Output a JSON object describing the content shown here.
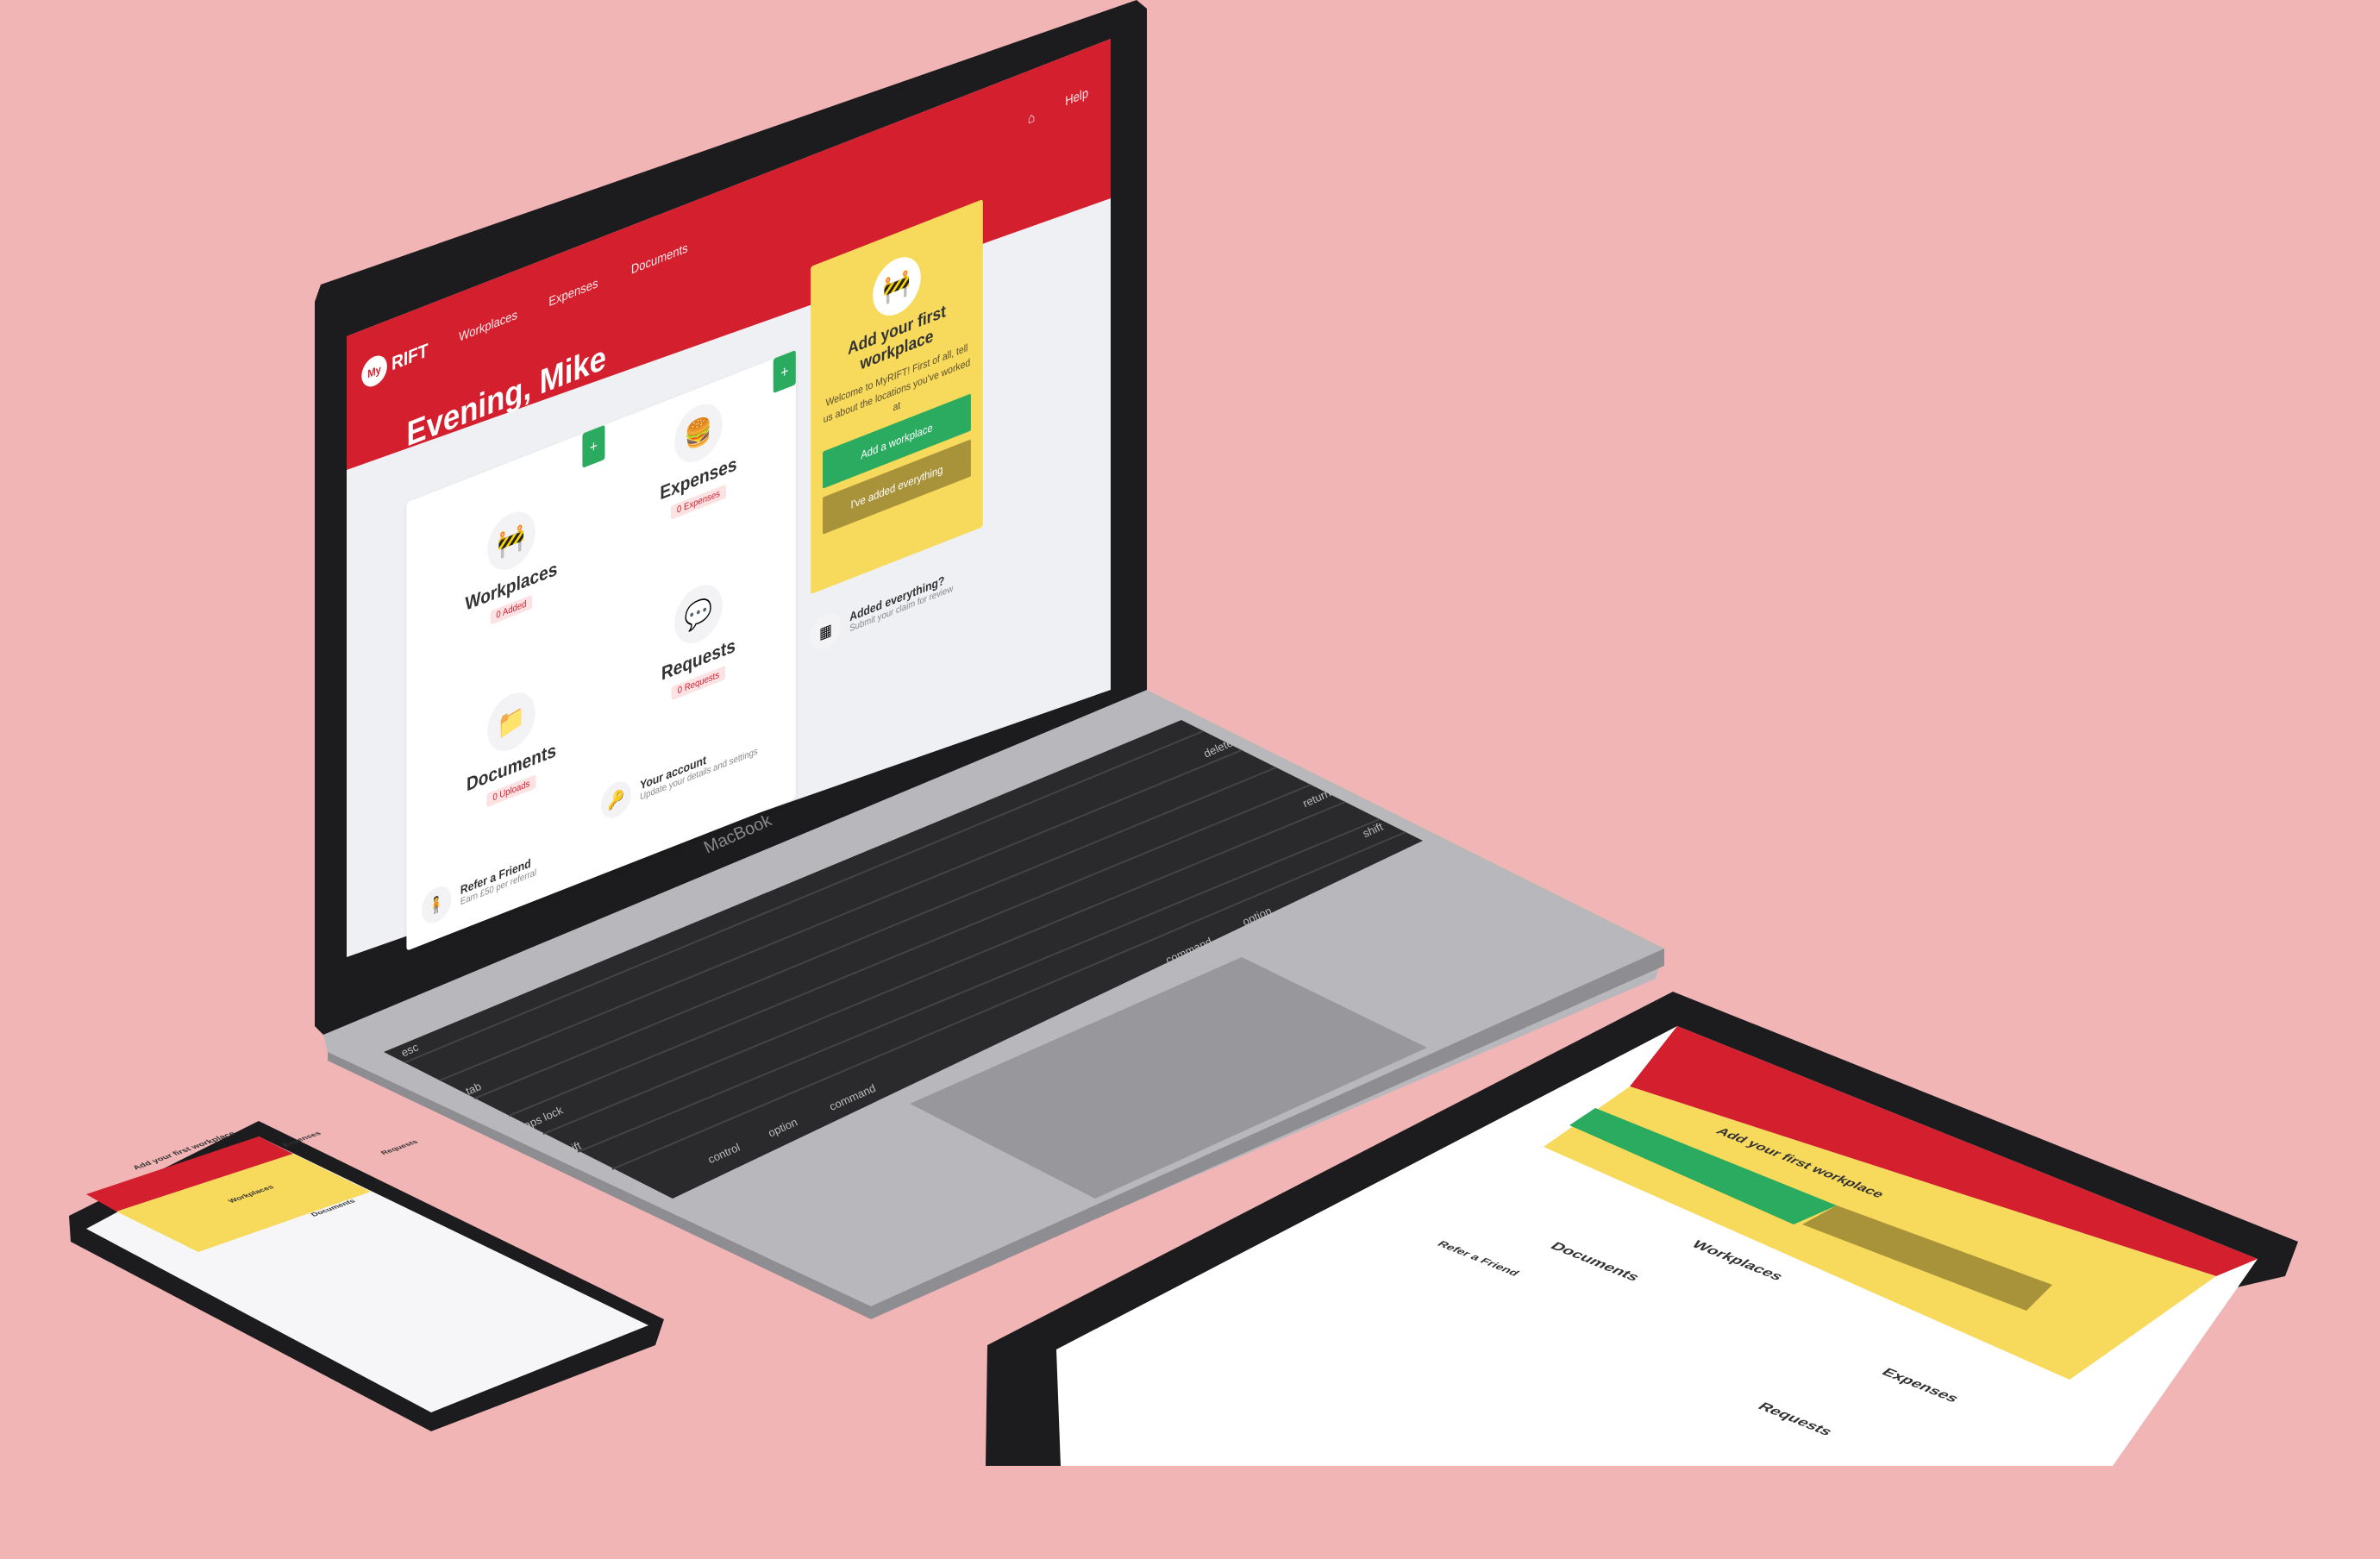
{
  "app": {
    "brand": "RIFT",
    "brand_prefix": "My",
    "nav": [
      "Workplaces",
      "Expenses",
      "Documents"
    ],
    "help_label": "Help",
    "greeting": "Evening, Mike"
  },
  "tiles": [
    {
      "title": "Workplaces",
      "badge": "0 Added",
      "icon": "barrier-icon"
    },
    {
      "title": "Expenses",
      "badge": "0 Expenses",
      "icon": "burger-icon"
    },
    {
      "title": "Requests",
      "badge": "0 Requests",
      "icon": "chat-icon"
    },
    {
      "title": "Documents",
      "badge": "0 Uploads",
      "icon": "folder-icon"
    }
  ],
  "promo": {
    "title": "Add your first workplace",
    "text": "Welcome to MyRIFT! First of all, tell us about the locations you've worked at",
    "primary_label": "Add a workplace",
    "secondary_label": "I've added everything"
  },
  "list": [
    {
      "title": "Your account",
      "sub": "Update your details and settings",
      "icon": "key-icon"
    },
    {
      "title": "Added everything?",
      "sub": "Submit your claim for review",
      "icon": "stripes-icon"
    },
    {
      "title": "Refer a Friend",
      "sub": "Earn £50 per referral",
      "icon": "person-icon"
    }
  ],
  "laptop_label": "MacBook",
  "keys": {
    "esc": "esc",
    "delete": "delete",
    "return": "return",
    "shift": "shift",
    "tab": "tab",
    "caps": "caps lock",
    "control": "control",
    "option": "option",
    "command": "command",
    "fn": "fn"
  },
  "colors": {
    "background": "#f2b5b6",
    "brand_red": "#d41f2e",
    "promo_yellow": "#f7d95c",
    "green": "#2aab5f",
    "olive": "#a8923a"
  }
}
